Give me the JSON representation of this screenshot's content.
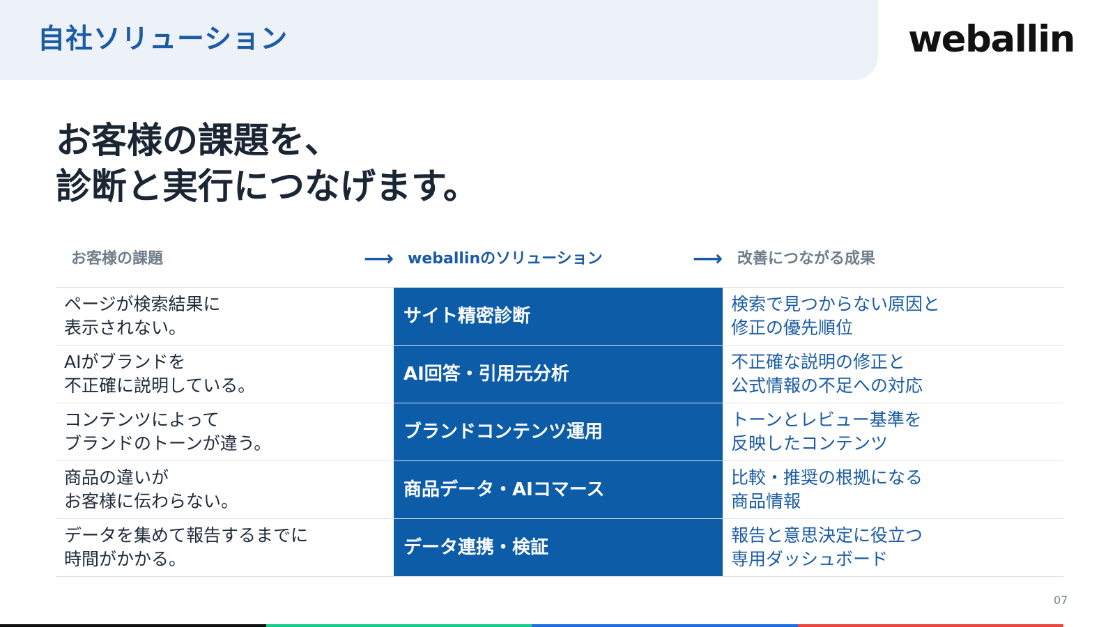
{
  "header": {
    "section_title": "自社ソリューション",
    "logo": "weballin"
  },
  "headline": {
    "line1": "お客様の課題を、",
    "line2": "診断と実行につなげます。"
  },
  "columns": {
    "problem": "お客様の課題",
    "solution": "weballinのソリューション",
    "result": "改善につながる成果",
    "arrow": "⟶"
  },
  "rows": [
    {
      "problem": "ページが検索結果に\n表示されない。",
      "solution": "サイト精密診断",
      "result": "検索で見つからない原因と\n修正の優先順位"
    },
    {
      "problem": "AIがブランドを\n不正確に説明している。",
      "solution": "AI回答・引用元分析",
      "result": "不正確な説明の修正と\n公式情報の不足への対応"
    },
    {
      "problem": "コンテンツによって\nブランドのトーンが違う。",
      "solution": "ブランドコンテンツ運用",
      "result": "トーンとレビュー基準を\n反映したコンテンツ"
    },
    {
      "problem": "商品の違いが\nお客様に伝わらない。",
      "solution": "商品データ・AIコマース",
      "result": "比較・推奨の根拠になる\n商品情報"
    },
    {
      "problem": "データを集めて報告するまでに\n時間がかかる。",
      "solution": "データ連携・検証",
      "result": "報告と意思決定に役立つ\n専用ダッシュボード"
    }
  ],
  "page_number": "07",
  "colors": {
    "accent_blue": "#1a5ba3",
    "solution_fill": "#0d5ca8",
    "header_band": "#edf2f8",
    "footer_segments": [
      "#111111",
      "#18c98a",
      "#1f6ee0",
      "#e8453c"
    ]
  }
}
